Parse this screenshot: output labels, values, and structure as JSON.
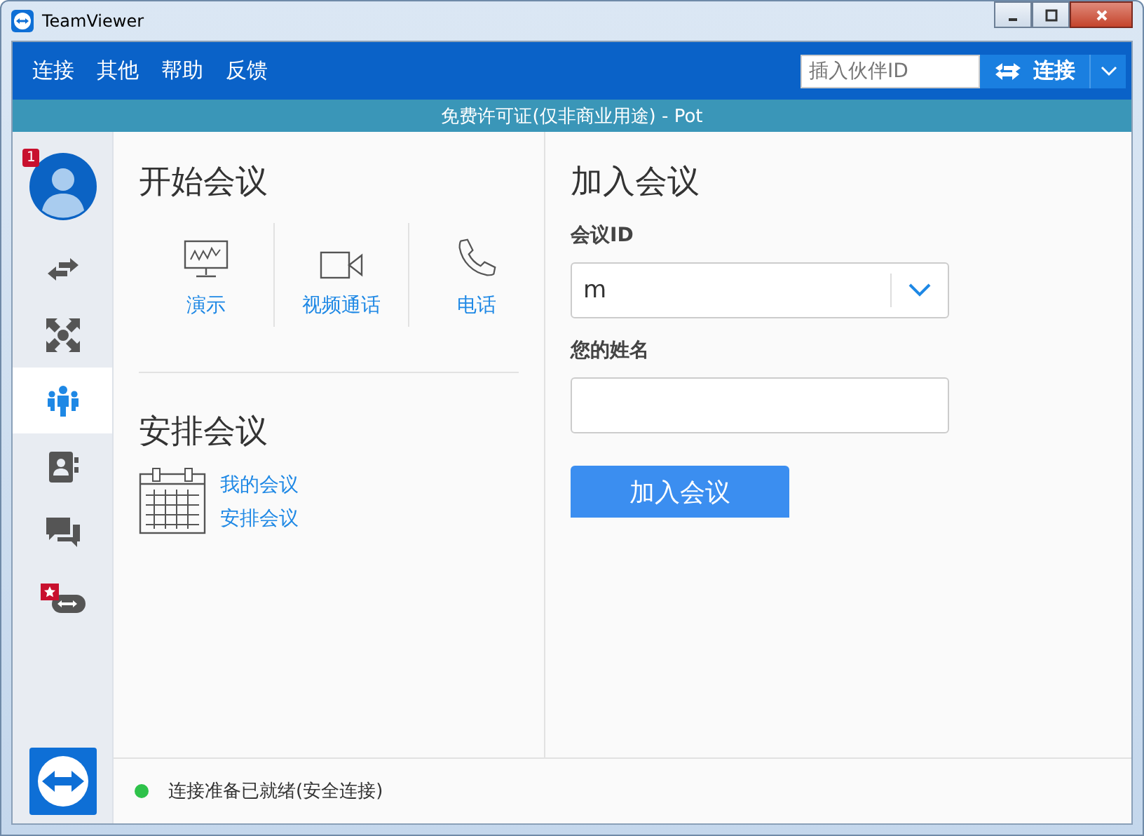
{
  "window": {
    "title": "TeamViewer"
  },
  "menu": [
    "连接",
    "其他",
    "帮助",
    "反馈"
  ],
  "partner": {
    "placeholder": "插入伙伴ID",
    "button": "连接"
  },
  "banner": "免费许可证(仅非商业用途) - Pot",
  "sidebar": {
    "badge": "1",
    "items": [
      {
        "kind": "transfer",
        "selected": false
      },
      {
        "kind": "expand",
        "selected": false
      },
      {
        "kind": "meeting",
        "selected": true
      },
      {
        "kind": "contacts",
        "selected": false
      },
      {
        "kind": "chat",
        "selected": false
      },
      {
        "kind": "remote",
        "selected": false
      }
    ]
  },
  "start": {
    "title": "开始会议",
    "actions": [
      {
        "kind": "presentation",
        "label": "演示"
      },
      {
        "kind": "video",
        "label": "视频通话"
      },
      {
        "kind": "phone",
        "label": "电话"
      }
    ]
  },
  "schedule": {
    "title": "安排会议",
    "links": [
      "我的会议",
      "安排会议"
    ]
  },
  "join": {
    "title": "加入会议",
    "id_label": "会议ID",
    "id_value": "m",
    "name_label": "您的姓名",
    "button": "加入会议"
  },
  "status": {
    "text": "连接准备已就绪(安全连接)",
    "ready": true
  }
}
